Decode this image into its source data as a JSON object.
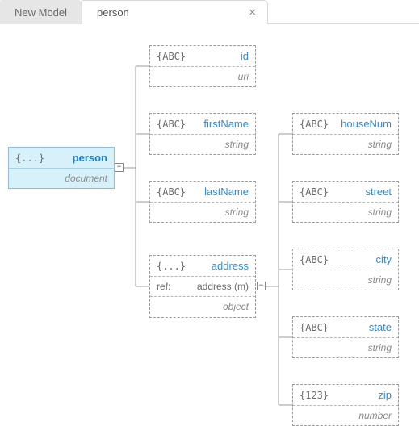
{
  "tabs": {
    "inactive": "New Model",
    "active": "person",
    "close_glyph": "×"
  },
  "root": {
    "icon": "{...}",
    "name": "person",
    "subtype": "document",
    "handle": "−"
  },
  "fields": {
    "id": {
      "icon": "{ABC}",
      "name": "id",
      "subtype": "uri"
    },
    "firstName": {
      "icon": "{ABC}",
      "name": "firstName",
      "subtype": "string"
    },
    "lastName": {
      "icon": "{ABC}",
      "name": "lastName",
      "subtype": "string"
    },
    "address": {
      "icon": "{...}",
      "name": "address",
      "ref_label": "ref:",
      "ref_value": "address (m)",
      "subtype": "object",
      "handle": "−"
    }
  },
  "address_fields": {
    "houseNum": {
      "icon": "{ABC}",
      "name": "houseNum",
      "subtype": "string"
    },
    "street": {
      "icon": "{ABC}",
      "name": "street",
      "subtype": "string"
    },
    "city": {
      "icon": "{ABC}",
      "name": "city",
      "subtype": "string"
    },
    "state": {
      "icon": "{ABC}",
      "name": "state",
      "subtype": "string"
    },
    "zip": {
      "icon": "{123}",
      "name": "zip",
      "subtype": "number"
    }
  }
}
